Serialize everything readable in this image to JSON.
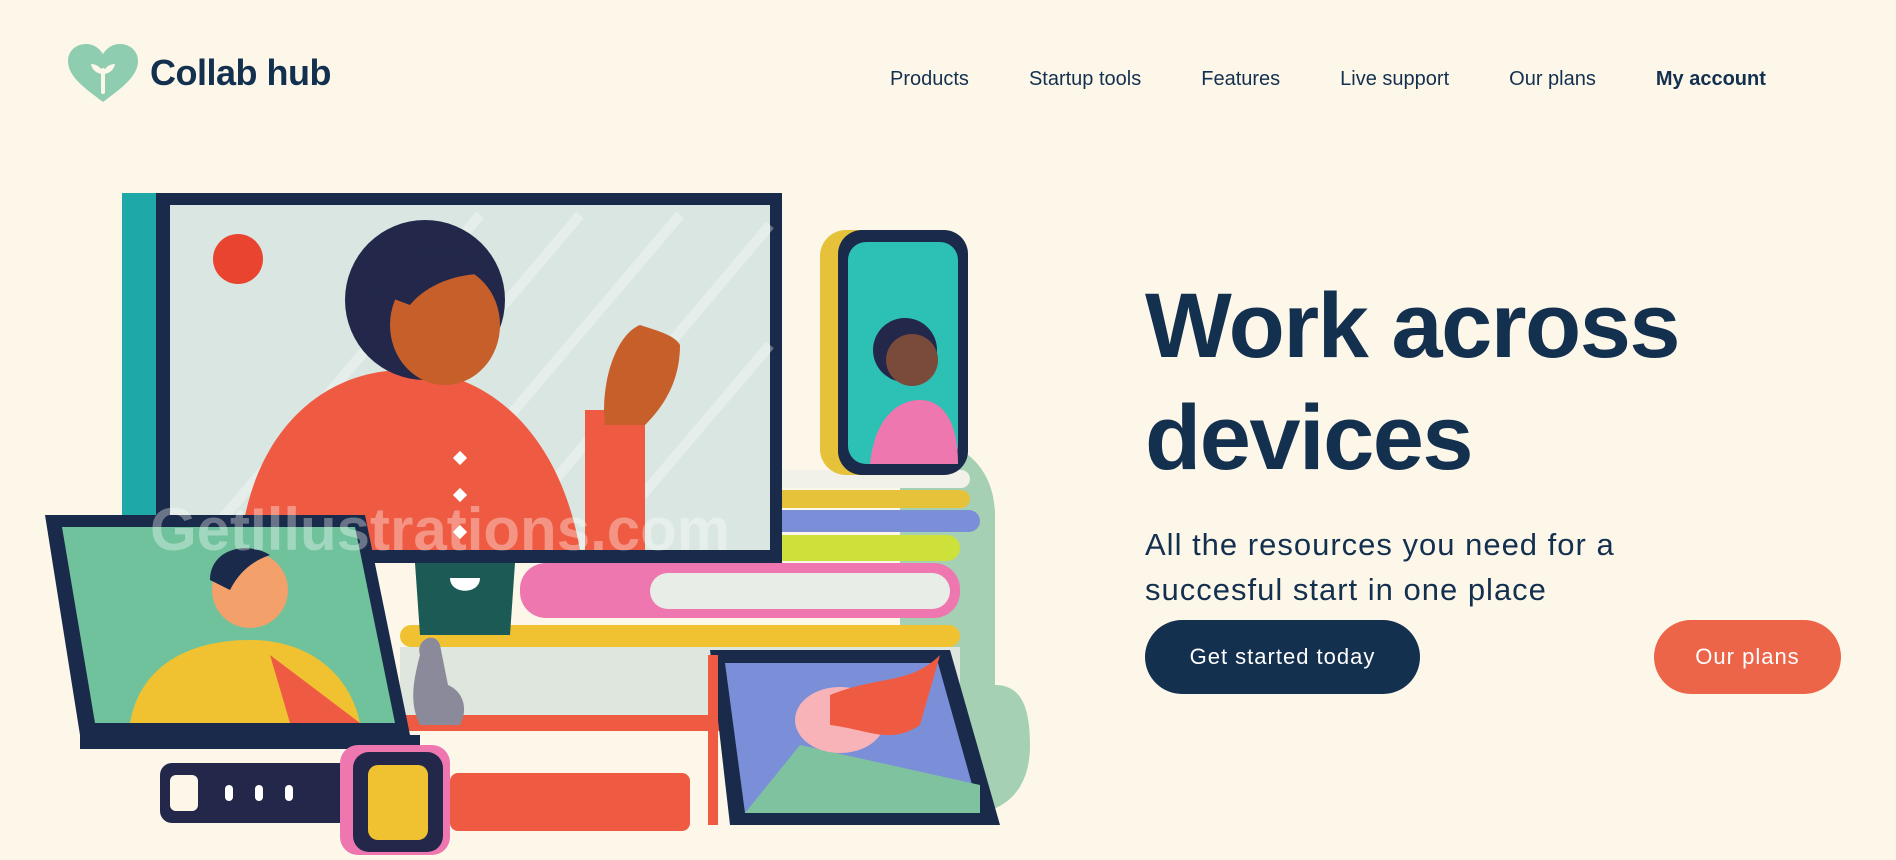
{
  "brand": {
    "name": "Collab hub",
    "logo_icon": "heart-sprout-icon",
    "accent": "#8ecdb0"
  },
  "nav": {
    "items": [
      {
        "label": "Products"
      },
      {
        "label": "Startup tools"
      },
      {
        "label": "Features"
      },
      {
        "label": "Live support"
      },
      {
        "label": "Our plans"
      },
      {
        "label": "My account"
      }
    ]
  },
  "hero": {
    "headline_line1": "Work across",
    "headline_line2": "devices",
    "subtitle_line1": "All the resources you need for a",
    "subtitle_line2": "succesful start in one place",
    "primary_cta": "Get started today",
    "secondary_cta": "Our plans",
    "illustration_watermark": "GetIllustrations.com"
  },
  "colors": {
    "background": "#fdf7ea",
    "navy": "#14304f",
    "coral": "#ec6549",
    "mint": "#8ecdb0"
  }
}
